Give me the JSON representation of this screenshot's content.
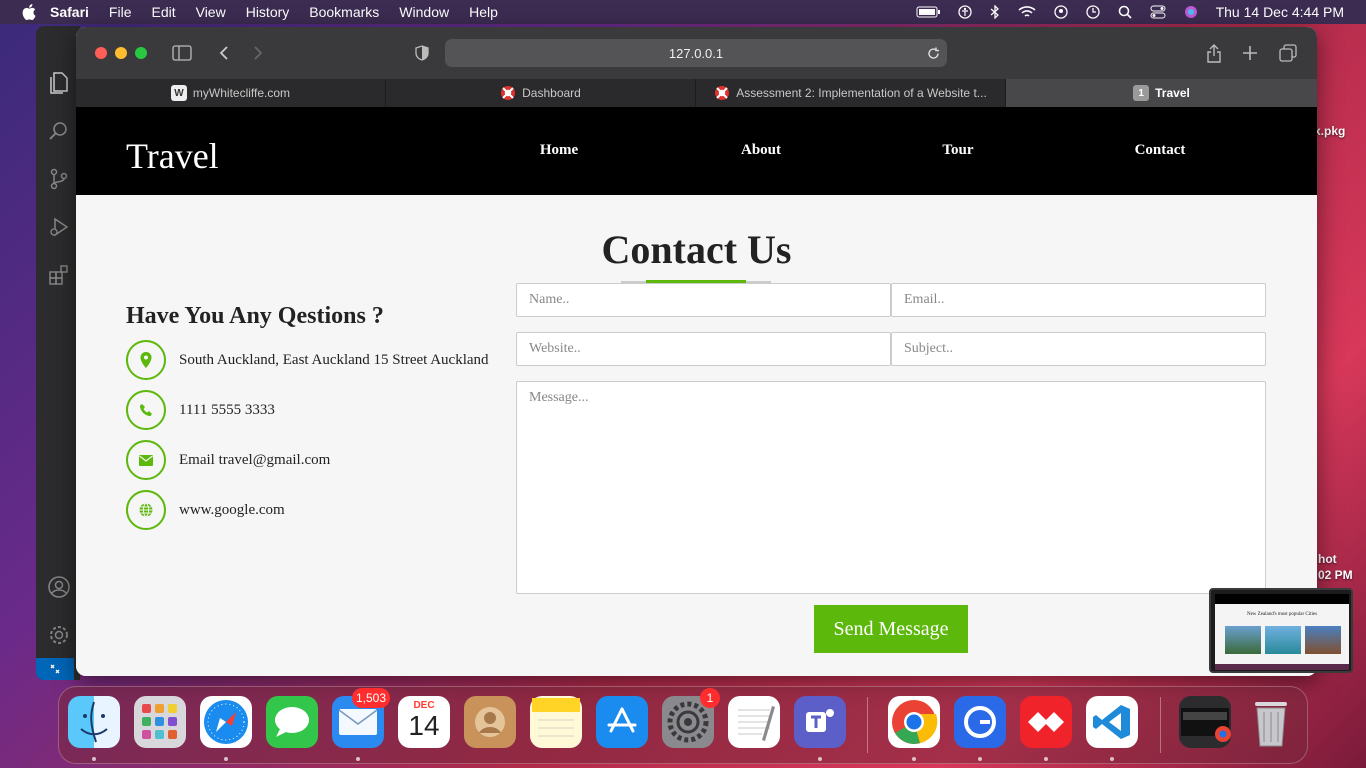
{
  "menubar": {
    "app_name": "Safari",
    "items": [
      "File",
      "Edit",
      "View",
      "History",
      "Bookmarks",
      "Window",
      "Help"
    ],
    "clock": "Thu 14 Dec  4:44 PM"
  },
  "browser": {
    "url": "127.0.0.1",
    "tabs": [
      {
        "label": "myWhitecliffe.com",
        "favicon": "W"
      },
      {
        "label": "Dashboard"
      },
      {
        "label": "Assessment 2: Implementation of a Website t..."
      },
      {
        "label": "Travel",
        "favicon": "1"
      }
    ]
  },
  "site": {
    "logo": "Travel",
    "nav": [
      "Home",
      "About",
      "Tour",
      "Contact"
    ],
    "title": "Contact Us",
    "subheading": "Have You Any Qestions ?",
    "info": {
      "address": "South Auckland, East Auckland 15 Street Auckland",
      "phone": "1111 5555 3333",
      "email": "Email travel@gmail.com",
      "website": "www.google.com"
    },
    "form": {
      "name_placeholder": "Name..",
      "email_placeholder": "Email..",
      "website_placeholder": "Website..",
      "subject_placeholder": "Subject..",
      "message_placeholder": "Message...",
      "submit_label": "Send Message"
    },
    "accent_color": "#5cb80a"
  },
  "thumbnail": {
    "caption": "New Zealand's most popular Cities"
  },
  "desktop": {
    "pkg_label": "x.pkg",
    "shot_label_line1": "hot",
    "shot_label_line2": "02 PM"
  },
  "dock": {
    "mail_badge": "1,503",
    "calendar_month": "DEC",
    "calendar_day": "14",
    "settings_badge": "1"
  }
}
